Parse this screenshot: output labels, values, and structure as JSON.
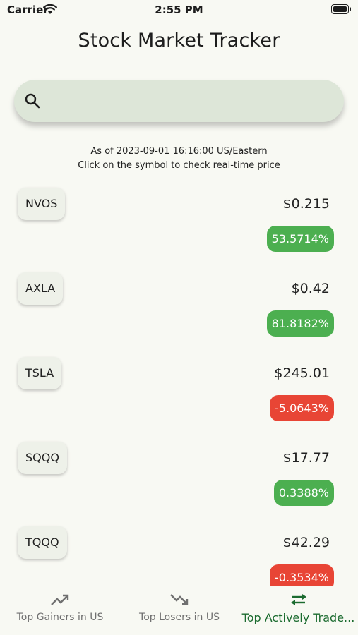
{
  "status_bar": {
    "carrier": "Carrier",
    "time": "2:55 PM"
  },
  "header": {
    "title": "Stock Market Tracker"
  },
  "search": {
    "placeholder": "",
    "value": ""
  },
  "info": {
    "as_of": "As of 2023-09-01 16:16:00 US/Eastern",
    "hint": "Click on the symbol to check real-time price"
  },
  "stocks": [
    {
      "symbol": "NVOS",
      "price": "$0.215",
      "change": "53.5714%",
      "color": "#4caf50"
    },
    {
      "symbol": "AXLA",
      "price": "$0.42",
      "change": "81.8182%",
      "color": "#4caf50"
    },
    {
      "symbol": "TSLA",
      "price": "$245.01",
      "change": "-5.0643%",
      "color": "#e84535"
    },
    {
      "symbol": "SQQQ",
      "price": "$17.77",
      "change": "0.3388%",
      "color": "#4caf50"
    },
    {
      "symbol": "TQQQ",
      "price": "$42.29",
      "change": "-0.3534%",
      "color": "#e84535"
    }
  ],
  "bottom_nav": {
    "tabs": [
      {
        "label": "Top Gainers in US",
        "icon": "trending-up-icon"
      },
      {
        "label": "Top Losers in US",
        "icon": "trending-down-icon"
      },
      {
        "label": "Top Actively Trade...",
        "icon": "swap-arrows-icon",
        "active": true
      }
    ]
  },
  "colors": {
    "background": "#f8f9f3",
    "search_bg": "#dde6d8",
    "active_tab": "#1b6b2f",
    "gain": "#4caf50",
    "loss": "#e84535"
  }
}
